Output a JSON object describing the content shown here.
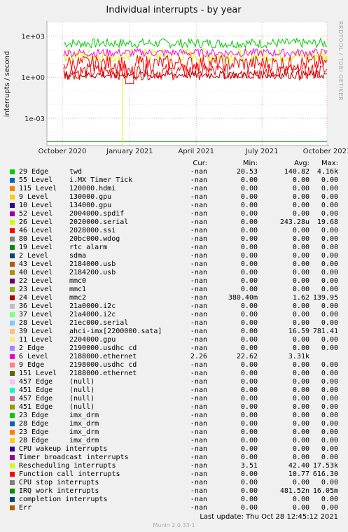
{
  "chart_data": {
    "type": "line",
    "title": "Individual interrupts - by year",
    "ylabel": "interrupts / second",
    "yscale": "log",
    "ylim": [
      1e-05,
      10000
    ],
    "ytick_labels": [
      "1e+03",
      "1e+00",
      "1e-03"
    ],
    "xtick_labels": [
      "October 2020",
      "January 2021",
      "April 2021",
      "July 2021",
      "October 2021"
    ],
    "side_label": "RRDTOOL / TOBI OETIKER",
    "grid": true,
    "series_summary_note": "",
    "series": [
      {
        "name": "twd",
        "color": "#00cc00"
      },
      {
        "name": "2020000.serial",
        "color": "#ccff00"
      },
      {
        "name": "2028000.ssi",
        "color": "#ff0000"
      },
      {
        "name": "2188000.ethernet",
        "color": "#ff00ff"
      },
      {
        "name": "Rescheduling interrupts",
        "color": "#ff0000"
      },
      {
        "name": "IRQ work interrupts",
        "color": "#007700"
      },
      {
        "name": "mmc2",
        "color": "#aa0000"
      }
    ]
  },
  "legend": {
    "headers": {
      "cur": "Cur:",
      "min": "Min:",
      "avg": "Avg:",
      "max": "Max:"
    },
    "rows": [
      {
        "type": "29 Edge",
        "name": "twd",
        "color": "#00cc00",
        "cur": "-nan",
        "min": "20.53",
        "avg": "140.82",
        "max": "4.16k"
      },
      {
        "type": "55 Level",
        "name": "i.MX Timer Tick",
        "color": "#0066b3",
        "cur": "-nan",
        "min": "0.00",
        "avg": "0.00",
        "max": "0.00"
      },
      {
        "type": "115 Level",
        "name": "120000.hdmi",
        "color": "#ff8000",
        "cur": "-nan",
        "min": "0.00",
        "avg": "0.00",
        "max": "0.00"
      },
      {
        "type": "9 Level",
        "name": "130000.gpu",
        "color": "#ffcc00",
        "cur": "-nan",
        "min": "0.00",
        "avg": "0.00",
        "max": "0.00"
      },
      {
        "type": "10 Level",
        "name": "134000.gpu",
        "color": "#330099",
        "cur": "-nan",
        "min": "0.00",
        "avg": "0.00",
        "max": "0.00"
      },
      {
        "type": "52 Level",
        "name": "2004000.spdif",
        "color": "#990099",
        "cur": "-nan",
        "min": "0.00",
        "avg": "0.00",
        "max": "0.00"
      },
      {
        "type": "26 Level",
        "name": "2020000.serial",
        "color": "#ccff00",
        "cur": "-nan",
        "min": "0.00",
        "avg": "243.28u",
        "max": "19.68"
      },
      {
        "type": "46 Level",
        "name": "2028000.ssi",
        "color": "#ff0000",
        "cur": "-nan",
        "min": "0.00",
        "avg": "0.00",
        "max": "0.00"
      },
      {
        "type": "80 Level",
        "name": "20bc000.wdog",
        "color": "#808080",
        "cur": "-nan",
        "min": "0.00",
        "avg": "0.00",
        "max": "0.00"
      },
      {
        "type": "19 Level",
        "name": "rtc alarm",
        "color": "#008f00",
        "cur": "-nan",
        "min": "0.00",
        "avg": "0.00",
        "max": "0.00"
      },
      {
        "type": "2 Level",
        "name": "sdma",
        "color": "#00487d",
        "cur": "-nan",
        "min": "0.00",
        "avg": "0.00",
        "max": "0.00"
      },
      {
        "type": "43 Level",
        "name": "2184000.usb",
        "color": "#b35a00",
        "cur": "-nan",
        "min": "0.00",
        "avg": "0.00",
        "max": "0.00"
      },
      {
        "type": "40 Level",
        "name": "2184200.usb",
        "color": "#b38f00",
        "cur": "-nan",
        "min": "0.00",
        "avg": "0.00",
        "max": "0.00"
      },
      {
        "type": "22 Level",
        "name": "mmc0",
        "color": "#6b006b",
        "cur": "-nan",
        "min": "0.00",
        "avg": "0.00",
        "max": "0.00"
      },
      {
        "type": "23 Level",
        "name": "mmc1",
        "color": "#8fb300",
        "cur": "-nan",
        "min": "0.00",
        "avg": "0.00",
        "max": "0.00"
      },
      {
        "type": "24 Level",
        "name": "mmc2",
        "color": "#b30000",
        "cur": "-nan",
        "min": "380.40m",
        "avg": "1.62",
        "max": "139.95"
      },
      {
        "type": "36 Level",
        "name": "21a0000.i2c",
        "color": "#bebebe",
        "cur": "-nan",
        "min": "0.00",
        "avg": "0.00",
        "max": "0.00"
      },
      {
        "type": "37 Level",
        "name": "21a4000.i2c",
        "color": "#80ff80",
        "cur": "-nan",
        "min": "0.00",
        "avg": "0.00",
        "max": "0.00"
      },
      {
        "type": "28 Level",
        "name": "21ec000.serial",
        "color": "#80c9ff",
        "cur": "-nan",
        "min": "0.00",
        "avg": "0.00",
        "max": "0.00"
      },
      {
        "type": "39 Level",
        "name": "ahci-imx[2200000.sata]",
        "color": "#ffc080",
        "cur": "-nan",
        "min": "0.00",
        "avg": "16.59",
        "max": "781.41"
      },
      {
        "type": "11 Level",
        "name": "2204000.gpu",
        "color": "#ffe680",
        "cur": "-nan",
        "min": "0.00",
        "avg": "0.00",
        "max": "0.00"
      },
      {
        "type": "2 Edge",
        "name": "2190000.usdhc cd",
        "color": "#aa80ff",
        "cur": "-nan",
        "min": "0.00",
        "avg": "0.00",
        "max": "0.00"
      },
      {
        "type": "6 Level",
        "name": "2188000.ethernet",
        "color": "#ee00cc",
        "cur": "2.26",
        "min": "22.62",
        "avg": "3.31k",
        "max": ""
      },
      {
        "type": "9 Edge",
        "name": "2198000.usdhc cd",
        "color": "#ff8080",
        "cur": "-nan",
        "min": "0.00",
        "avg": "0.00",
        "max": "0.00"
      },
      {
        "type": "151 Level",
        "name": "2188000.ethernet",
        "color": "#666600",
        "cur": "-nan",
        "min": "0.00",
        "avg": "0.00",
        "max": "0.00"
      },
      {
        "type": "457 Edge",
        "name": "(null)",
        "color": "#ffbfff",
        "cur": "-nan",
        "min": "0.00",
        "avg": "0.00",
        "max": "0.00"
      },
      {
        "type": "451 Edge",
        "name": "(null)",
        "color": "#00ffcc",
        "cur": "-nan",
        "min": "0.00",
        "avg": "0.00",
        "max": "0.00"
      },
      {
        "type": "457 Edge",
        "name": "(null)",
        "color": "#cc6699",
        "cur": "-nan",
        "min": "0.00",
        "avg": "0.00",
        "max": "0.00"
      },
      {
        "type": "451 Edge",
        "name": "(null)",
        "color": "#999900",
        "cur": "-nan",
        "min": "0.00",
        "avg": "0.00",
        "max": "0.00"
      },
      {
        "type": "23 Edge",
        "name": "imx_drm",
        "color": "#00cc00",
        "cur": "-nan",
        "min": "0.00",
        "avg": "0.00",
        "max": "0.00"
      },
      {
        "type": "28 Edge",
        "name": "imx_drm",
        "color": "#0066b3",
        "cur": "-nan",
        "min": "0.00",
        "avg": "0.00",
        "max": "0.00"
      },
      {
        "type": "23 Edge",
        "name": "imx_drm",
        "color": "#ff8000",
        "cur": "-nan",
        "min": "0.00",
        "avg": "0.00",
        "max": "0.00"
      },
      {
        "type": "28 Edge",
        "name": "imx_drm",
        "color": "#ffcc00",
        "cur": "-nan",
        "min": "0.00",
        "avg": "0.00",
        "max": "0.00"
      },
      {
        "type": "",
        "name": "CPU wakeup interrupts",
        "color": "#330099",
        "cur": "-nan",
        "min": "0.00",
        "avg": "0.00",
        "max": "0.00"
      },
      {
        "type": "",
        "name": "Timer broadcast interrupts",
        "color": "#990099",
        "cur": "-nan",
        "min": "0.00",
        "avg": "0.00",
        "max": "0.00"
      },
      {
        "type": "",
        "name": "Rescheduling interrupts",
        "color": "#ccff00",
        "cur": "-nan",
        "min": "3.51",
        "avg": "42.40",
        "max": "17.53k"
      },
      {
        "type": "",
        "name": "Function call interrupts",
        "color": "#ff0000",
        "cur": "-nan",
        "min": "0.00",
        "avg": "10.77",
        "max": "616.30"
      },
      {
        "type": "",
        "name": "CPU stop interrupts",
        "color": "#808080",
        "cur": "-nan",
        "min": "0.00",
        "avg": "0.00",
        "max": "0.00"
      },
      {
        "type": "",
        "name": "IRQ work interrupts",
        "color": "#008f00",
        "cur": "-nan",
        "min": "0.00",
        "avg": "481.52n",
        "max": "16.05m"
      },
      {
        "type": "",
        "name": "completion interrupts",
        "color": "#00487d",
        "cur": "-nan",
        "min": "0.00",
        "avg": "0.00",
        "max": "0.00"
      },
      {
        "type": "",
        "name": "Err",
        "color": "#b35a00",
        "cur": "-nan",
        "min": "0.00",
        "avg": "0.00",
        "max": "0.00"
      }
    ]
  },
  "footer": {
    "last_update": "Last update:  Thu Oct 28 12:45:12 2021",
    "munin": "Munin 2.0.33-1"
  }
}
